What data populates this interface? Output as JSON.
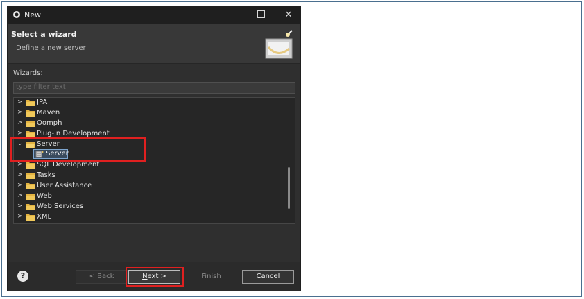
{
  "window": {
    "title": "New",
    "minimize": "—",
    "close": "✕"
  },
  "header": {
    "title": "Select a wizard",
    "description": "Define a new server"
  },
  "wizards_label": "Wizards:",
  "filter": {
    "placeholder": "type filter text",
    "value": ""
  },
  "tree": {
    "items": [
      {
        "label": "JPA",
        "expanded": false
      },
      {
        "label": "Maven",
        "expanded": false
      },
      {
        "label": "Oomph",
        "expanded": false
      },
      {
        "label": "Plug-in Development",
        "expanded": false
      },
      {
        "label": "Server",
        "expanded": true
      },
      {
        "label": "SQL Development",
        "expanded": false
      },
      {
        "label": "Tasks",
        "expanded": false
      },
      {
        "label": "User Assistance",
        "expanded": false
      },
      {
        "label": "Web",
        "expanded": false
      },
      {
        "label": "Web Services",
        "expanded": false
      },
      {
        "label": "XML",
        "expanded": false
      }
    ],
    "selected_child": {
      "label": "Server"
    }
  },
  "footer": {
    "help": "?",
    "back": "< Back",
    "next_mnemonic": "N",
    "next_rest": "ext >",
    "finish": "Finish",
    "cancel": "Cancel"
  },
  "colors": {
    "highlight": "#e02020",
    "accent": "#7ea6cf"
  }
}
